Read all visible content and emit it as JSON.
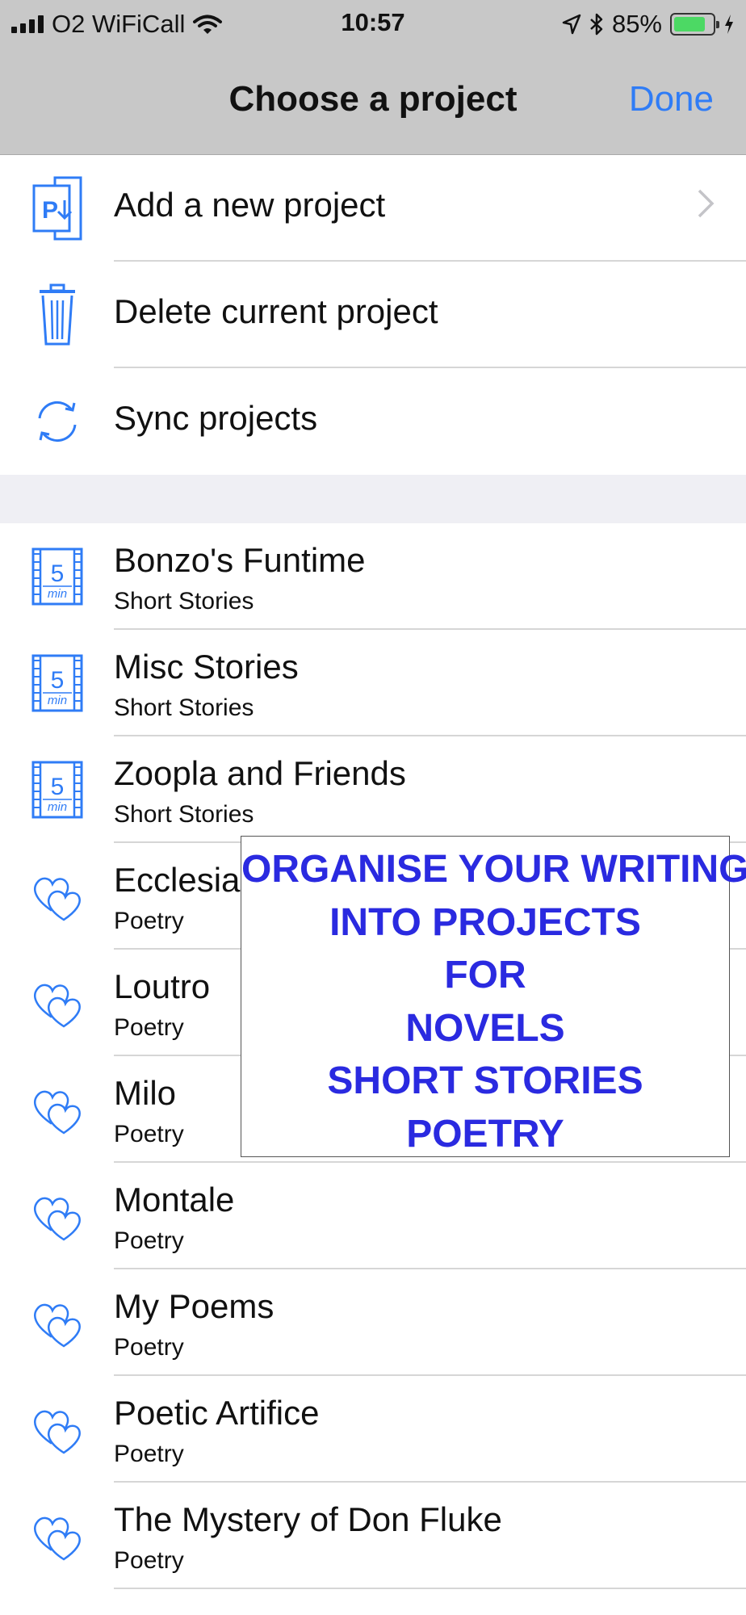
{
  "status_bar": {
    "carrier": "O2 WiFiCall",
    "time": "10:57",
    "battery": "85%",
    "battery_level": 0.85,
    "icons": [
      "signal-icon",
      "wifi-icon",
      "location-arrow-icon",
      "bluetooth-icon",
      "battery-icon",
      "charging-bolt-icon"
    ]
  },
  "nav": {
    "title": "Choose a project",
    "done_label": "Done"
  },
  "actions": [
    {
      "label": "Add a new project",
      "icon": "add-project-icon"
    },
    {
      "label": "Delete current project",
      "icon": "trash-icon"
    },
    {
      "label": "Sync projects",
      "icon": "sync-icon"
    }
  ],
  "projects": [
    {
      "title": "Bonzo's Funtime",
      "type": "Short Stories",
      "icon": "5-min-film-icon"
    },
    {
      "title": "Misc Stories",
      "type": "Short Stories",
      "icon": "5-min-film-icon"
    },
    {
      "title": "Zoopla and Friends",
      "type": "Short Stories",
      "icon": "5-min-film-icon"
    },
    {
      "title": "Ecclesia",
      "type": "Poetry",
      "icon": "hearts-icon"
    },
    {
      "title": "Loutro",
      "type": "Poetry",
      "icon": "hearts-icon"
    },
    {
      "title": "Milo",
      "type": "Poetry",
      "icon": "hearts-icon"
    },
    {
      "title": "Montale",
      "type": "Poetry",
      "icon": "hearts-icon"
    },
    {
      "title": "My Poems",
      "type": "Poetry",
      "icon": "hearts-icon"
    },
    {
      "title": "Poetic Artifice",
      "type": "Poetry",
      "icon": "hearts-icon"
    },
    {
      "title": "The Mystery of Don Fluke",
      "type": "Poetry",
      "icon": "hearts-icon"
    }
  ],
  "film_icon_text": {
    "number": "5",
    "unit": "min"
  },
  "promo": {
    "lines": [
      "ORGANISE YOUR WRITING",
      "INTO PROJECTS",
      "FOR",
      "NOVELS",
      "SHORT STORIES",
      "POETRY"
    ]
  },
  "colors": {
    "accent": "#2f7cf6",
    "promo_text": "#2a2ae0",
    "bar_background": "#c8c8c8",
    "battery_fill": "#4cd964"
  }
}
